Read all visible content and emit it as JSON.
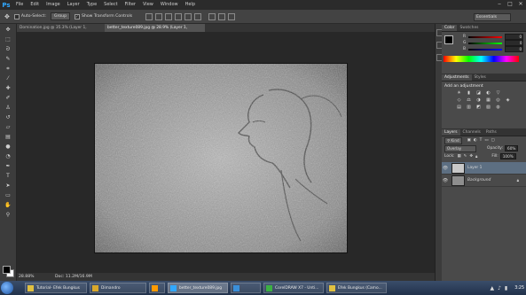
{
  "app": {
    "logo": "Ps"
  },
  "menu": [
    "File",
    "Edit",
    "Image",
    "Layer",
    "Type",
    "Select",
    "Filter",
    "View",
    "Window",
    "Help"
  ],
  "window_controls": [
    "‒",
    "□",
    "✕"
  ],
  "options_bar": {
    "auto_select_label": "Auto-Select:",
    "auto_select_value": "Group",
    "transform_label": "Show Transform Controls",
    "workspace": "Essentials"
  },
  "document_tabs": [
    {
      "label": "Domination.jpg @ 35.3% (Layer 1, RGB/8#)",
      "close": "×"
    },
    {
      "label": "better_texture089.jpg @ 28.9% (Layer 1, RGB/8#)",
      "close": "×"
    }
  ],
  "status": {
    "zoom": "28.88%",
    "doc": "Doc: 11.2M/16.9M"
  },
  "color_panel": {
    "tabs": [
      "Color",
      "Swatches"
    ],
    "channels": [
      {
        "label": "R",
        "value": "0"
      },
      {
        "label": "G",
        "value": "0"
      },
      {
        "label": "B",
        "value": "0"
      }
    ]
  },
  "adjustments_panel": {
    "tabs": [
      "Adjustments",
      "Styles"
    ],
    "heading": "Add an adjustment",
    "icons": [
      "☀",
      "▮",
      "◪",
      "◐",
      "▽",
      "◇",
      "⚖",
      "◑",
      "▦",
      "◎",
      "◈",
      "▤",
      "▥",
      "◩",
      "▧",
      "◍",
      "▨"
    ]
  },
  "layers_panel": {
    "tabs": [
      "Layers",
      "Channels",
      "Paths"
    ],
    "kind_label": "Kind",
    "blend_mode": "Overlay",
    "opacity_label": "Opacity:",
    "opacity_value": "60%",
    "lock_label": "Lock:",
    "fill_label": "Fill:",
    "fill_value": "100%",
    "layers": [
      {
        "name": "Layer 1",
        "selected": true
      },
      {
        "name": "Background",
        "selected": false
      }
    ]
  },
  "taskbar": {
    "tasks": [
      {
        "label": "Tutorial- Efek Bungkus",
        "active": false,
        "color": "#e0c040"
      },
      {
        "label": "Dimandro",
        "active": false,
        "color": "#d9a82b"
      },
      {
        "label": "Ai",
        "active": false,
        "color": "#ff9a00"
      },
      {
        "label": "better_texture089.jpg",
        "active": true,
        "color": "#31a8ff"
      },
      {
        "label": "CorelDRAW X7 - Unti...",
        "active": false,
        "color": "#3cb043"
      },
      {
        "label": "Efek Bungkus (Camo...",
        "active": false,
        "color": "#e0c040"
      }
    ],
    "clock": "3:25"
  }
}
